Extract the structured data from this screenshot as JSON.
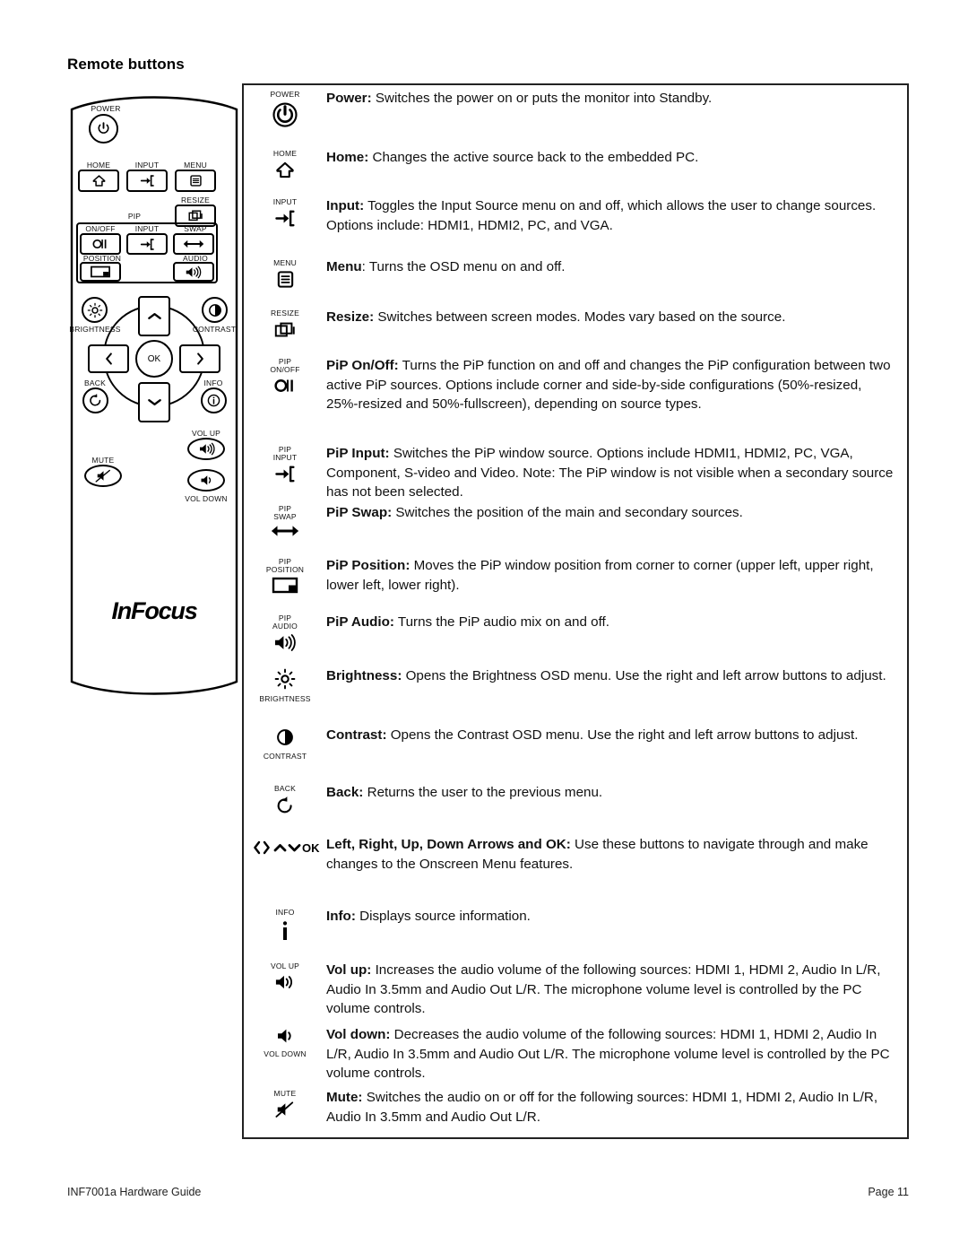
{
  "heading": "Remote buttons",
  "remote": {
    "brand_logo": "InFocus",
    "labels": {
      "power": "POWER",
      "home": "HOME",
      "input": "INPUT",
      "menu": "MENU",
      "resize": "RESIZE",
      "pip": "PIP",
      "pip_onoff": "ON/OFF",
      "pip_input": "INPUT",
      "pip_swap": "SWAP",
      "pip_position": "POSITION",
      "pip_audio": "AUDIO",
      "brightness": "BRIGHTNESS",
      "contrast": "CONTRAST",
      "ok": "OK",
      "back": "BACK",
      "info": "INFO",
      "vol_up": "VOL UP",
      "vol_down": "VOL DOWN",
      "mute": "MUTE"
    }
  },
  "descriptions": [
    {
      "icon_caption": "POWER",
      "icon": "power-icon",
      "term": "Power:",
      "body": " Switches the power on or puts the monitor into Standby."
    },
    {
      "icon_caption": "HOME",
      "icon": "home-icon",
      "term": "Home:",
      "body": " Changes the active source back to the embedded PC."
    },
    {
      "icon_caption": "INPUT",
      "icon": "input-icon",
      "term": "Input:",
      "body": " Toggles the Input Source menu on and off, which allows the user to change sources. Options include: HDMI1, HDMI2, PC, and VGA."
    },
    {
      "icon_caption": "MENU",
      "icon": "menu-icon",
      "term": "Menu",
      "body": ": Turns the OSD menu on and off."
    },
    {
      "icon_caption": "RESIZE",
      "icon": "resize-icon",
      "term": "Resize:",
      "body": " Switches between screen modes. Modes vary based on the source."
    },
    {
      "icon_caption": "PIP\nON/OFF",
      "icon": "pip-onoff-icon",
      "term": "PiP On/Off:",
      "body": " Turns the PiP function on and off and changes the PiP configuration between two active PiP sources. Options include corner and side-by-side configurations (50%-resized, 25%-resized and 50%-fullscreen), depending on source types."
    },
    {
      "icon_caption": "PIP\nINPUT",
      "icon": "pip-input-icon",
      "term": "PiP Input:",
      "body": " Switches the PiP window source. Options include HDMI1, HDMI2, PC, VGA, Component, S-video and Video. Note: The PiP window is not visible when a secondary source has not been selected."
    },
    {
      "icon_caption": "PIP\nSWAP",
      "icon": "pip-swap-icon",
      "term": "PiP Swap:",
      "body": " Switches the position of the main and secondary sources."
    },
    {
      "icon_caption": "PIP\nPOSITION",
      "icon": "pip-position-icon",
      "term": "PiP Position:",
      "body": " Moves the PiP window position from corner to corner (upper left, upper right, lower left, lower right)."
    },
    {
      "icon_caption": "PIP\nAUDIO",
      "icon": "pip-audio-icon",
      "term": "PiP Audio:",
      "body": " Turns the PiP audio mix on and off."
    },
    {
      "icon_caption": "BRIGHTNESS",
      "icon": "brightness-icon",
      "term": "Brightness:",
      "body": " Opens the Brightness OSD menu. Use the right and left arrow buttons to adjust."
    },
    {
      "icon_caption": "CONTRAST",
      "icon": "contrast-icon",
      "term": "Contrast:",
      "body": " Opens the Contrast OSD menu. Use the right and left arrow buttons to adjust."
    },
    {
      "icon_caption": "BACK",
      "icon": "back-icon",
      "term": "Back:",
      "body": " Returns the user to the previous menu."
    },
    {
      "icon_caption": "OK",
      "icon": "arrows-ok-icon",
      "term": "Left, Right, Up, Down Arrows and OK:",
      "body": " Use these buttons to navigate through and make changes to the Onscreen Menu features."
    },
    {
      "icon_caption": "INFO",
      "icon": "info-icon",
      "term": "Info:",
      "body": " Displays source information."
    },
    {
      "icon_caption": "VOL UP",
      "icon": "volume-up-icon",
      "term": "Vol up:",
      "body": " Increases the audio volume of the following sources: HDMI 1, HDMI 2, Audio In L/R, Audio In 3.5mm and Audio Out L/R. The microphone volume level is controlled by the PC volume controls."
    },
    {
      "icon_caption": "VOL DOWN",
      "icon": "volume-down-icon",
      "term": "Vol down:",
      "body": " Decreases the audio volume of the following sources: HDMI 1, HDMI 2, Audio In L/R, Audio In 3.5mm and Audio Out L/R. The microphone volume level is controlled by the PC volume controls."
    },
    {
      "icon_caption": "MUTE",
      "icon": "mute-icon",
      "term": "Mute:",
      "body": " Switches the audio on or off for the following sources: HDMI 1, HDMI 2, Audio In L/R, Audio In 3.5mm and Audio Out L/R."
    }
  ],
  "footer": {
    "left": "INF7001a Hardware Guide",
    "right": "Page 11"
  }
}
